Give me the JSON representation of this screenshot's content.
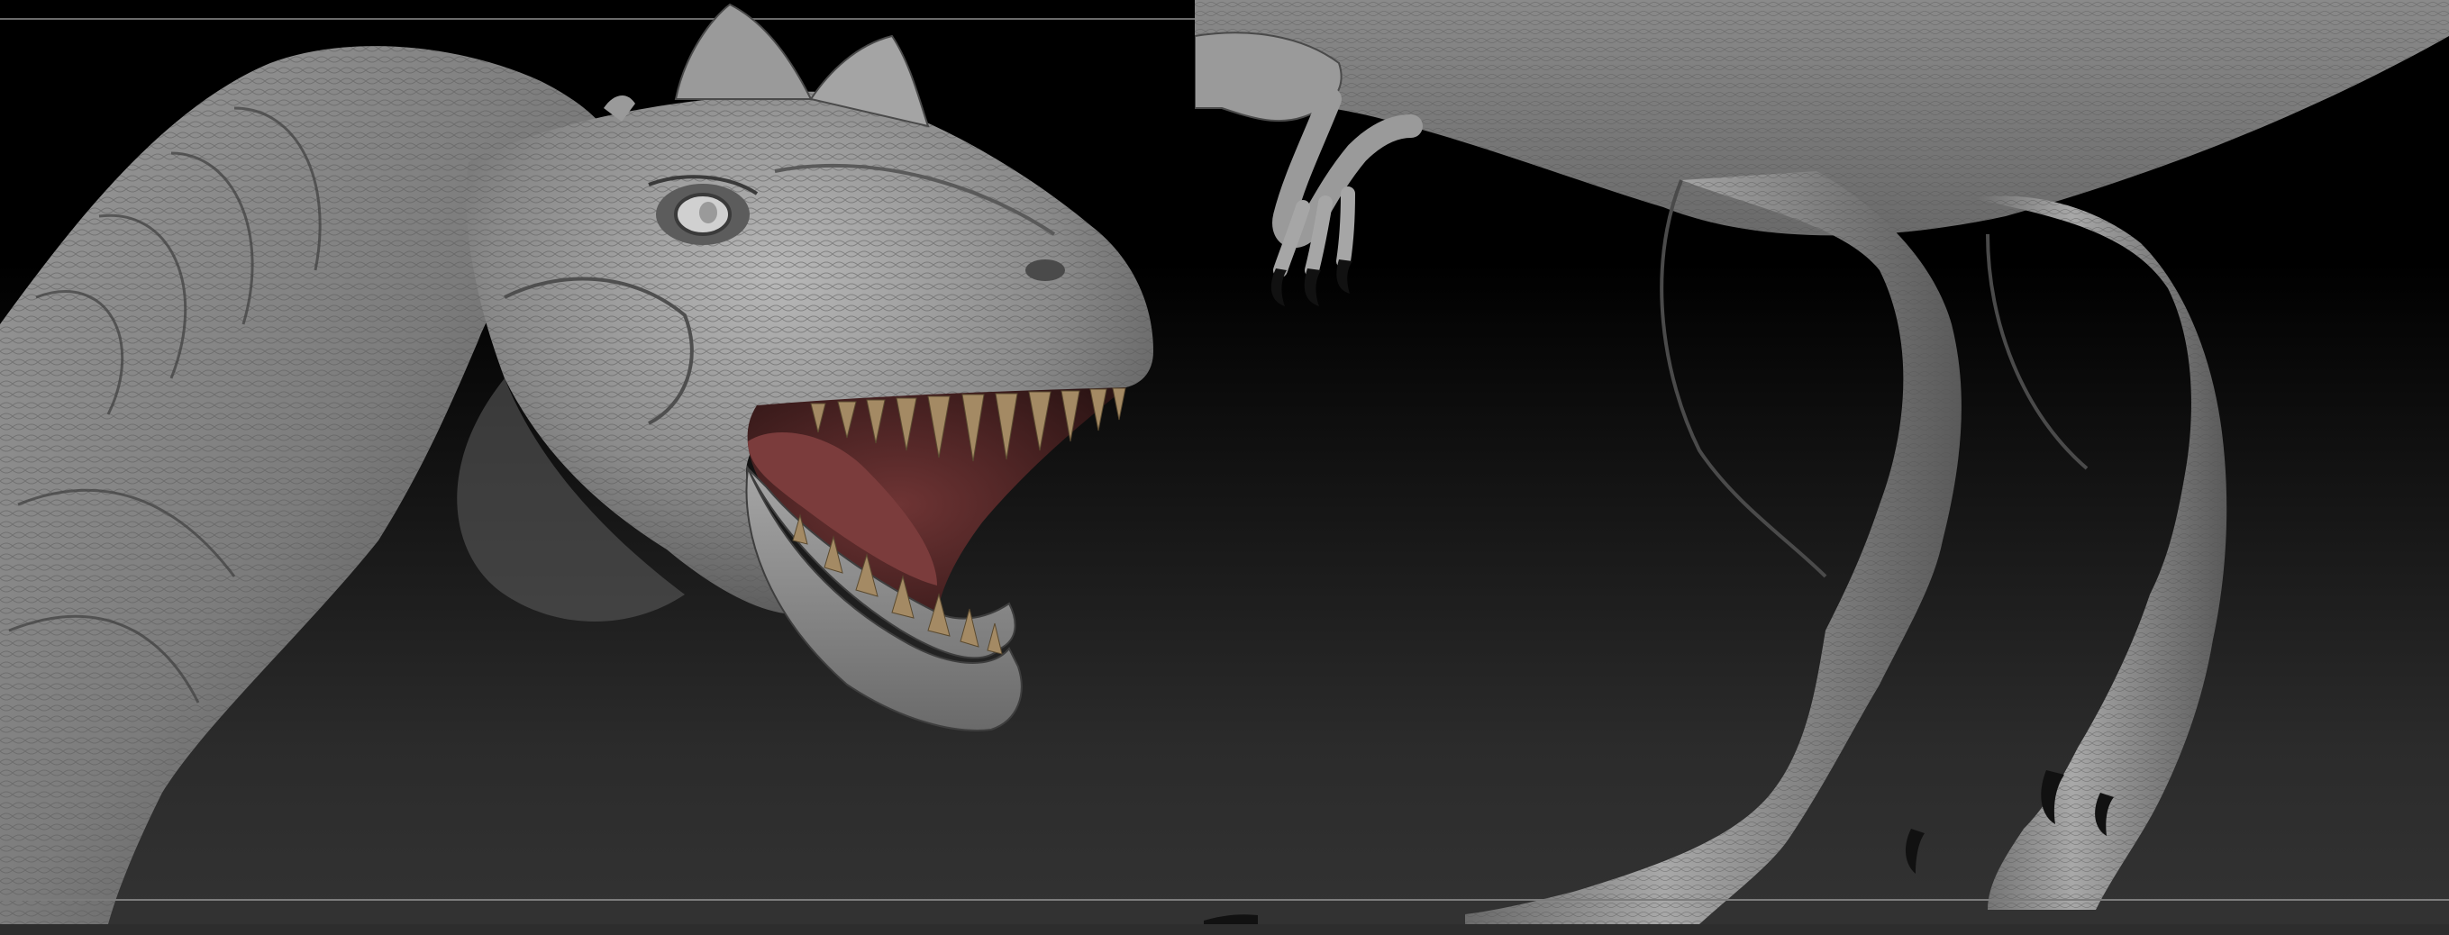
{
  "scene": {
    "subject": "",
    "colors": {
      "background_top": "#000000",
      "background_bottom": "#333333",
      "sculpt_gray": "#8e8e8e",
      "sculpt_light": "#c4c4c4",
      "sculpt_shadow": "#4a4a4a",
      "mouth_interior": "#5a2a2a",
      "teeth": "#a08660",
      "claws": "#111111",
      "divider_line": "#6a6a6a"
    }
  }
}
